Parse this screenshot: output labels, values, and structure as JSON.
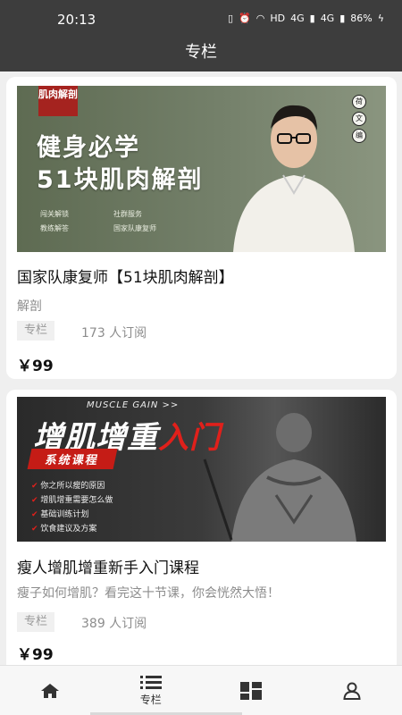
{
  "status_bar": {
    "time": "20:13",
    "network": "HD",
    "signal1": "4G",
    "signal2": "4G",
    "battery": "86%"
  },
  "header": {
    "title": "专栏"
  },
  "courses": [
    {
      "cover": {
        "corner_tag": "肌肉解剖",
        "title_line1": "健身必学",
        "title_line2": "51块肌肉解剖",
        "features": [
          "闯关解锁",
          "社群服务",
          "教练解答",
          "国家队康复师"
        ],
        "seal": [
          "荷",
          "文",
          "编"
        ]
      },
      "title": "国家队康复师【51块肌肉解剖】",
      "description": "解剖",
      "badge": "专栏",
      "subscribers": "173 人订阅",
      "price": "￥99"
    },
    {
      "cover": {
        "top_text": "MUSCLE GAIN >>",
        "title_main": "增肌增重",
        "title_red": "入门",
        "badge": "系统课程",
        "points": [
          "你之所以瘦的原因",
          "增肌增重需要怎么做",
          "基础训练计划",
          "饮食建议及方案"
        ]
      },
      "title": "瘦人增肌增重新手入门课程",
      "description": "瘦子如何增肌？看完这十节课，你会恍然大悟！",
      "badge": "专栏",
      "subscribers": "389 人订阅",
      "price": "￥99"
    }
  ],
  "tabbar": {
    "items": [
      {
        "icon": "home-icon",
        "label": ""
      },
      {
        "icon": "list-icon",
        "label": "专栏"
      },
      {
        "icon": "grid-icon",
        "label": ""
      },
      {
        "icon": "user-icon",
        "label": ""
      }
    ]
  }
}
